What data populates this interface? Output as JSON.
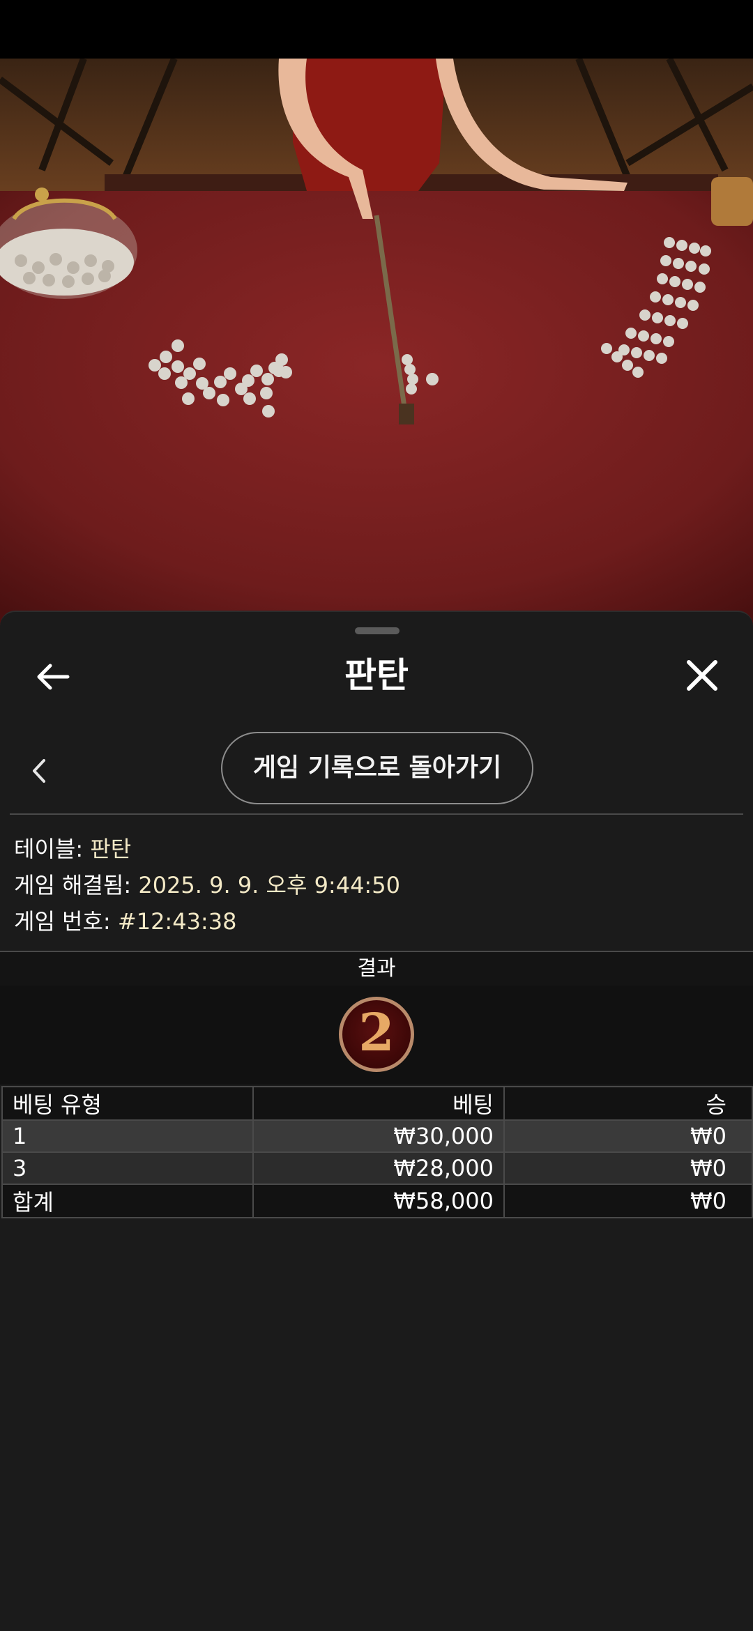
{
  "header": {
    "title": "판탄",
    "back_icon": "arrow-left-icon",
    "close_icon": "close-icon"
  },
  "navigation": {
    "prev_icon": "chevron-left-icon",
    "return_button_label": "게임 기록으로 돌아가기"
  },
  "game_info": {
    "table_label": "테이블: ",
    "table_value": "판탄",
    "resolved_label": "게임 해결됨: ",
    "resolved_value": "2025. 9. 9. 오후 9:44:50",
    "number_label": "게임 번호: ",
    "number_value": "#12:43:38"
  },
  "result": {
    "header": "결과",
    "value": "2"
  },
  "bets_table": {
    "columns": [
      "베팅 유형",
      "베팅",
      "승"
    ],
    "rows": [
      {
        "type": "1",
        "bet": "₩30,000",
        "win": "₩0"
      },
      {
        "type": "3",
        "bet": "₩28,000",
        "win": "₩0"
      }
    ],
    "total": {
      "type": "합계",
      "bet": "₩58,000",
      "win": "₩0"
    }
  },
  "colors": {
    "sheet_bg": "#1b1b1b",
    "info_value": "#f3e9c6",
    "result_badge_bg": "#3c0707",
    "result_badge_text": "#e7a965",
    "table_felt": "#7a1f1f"
  }
}
